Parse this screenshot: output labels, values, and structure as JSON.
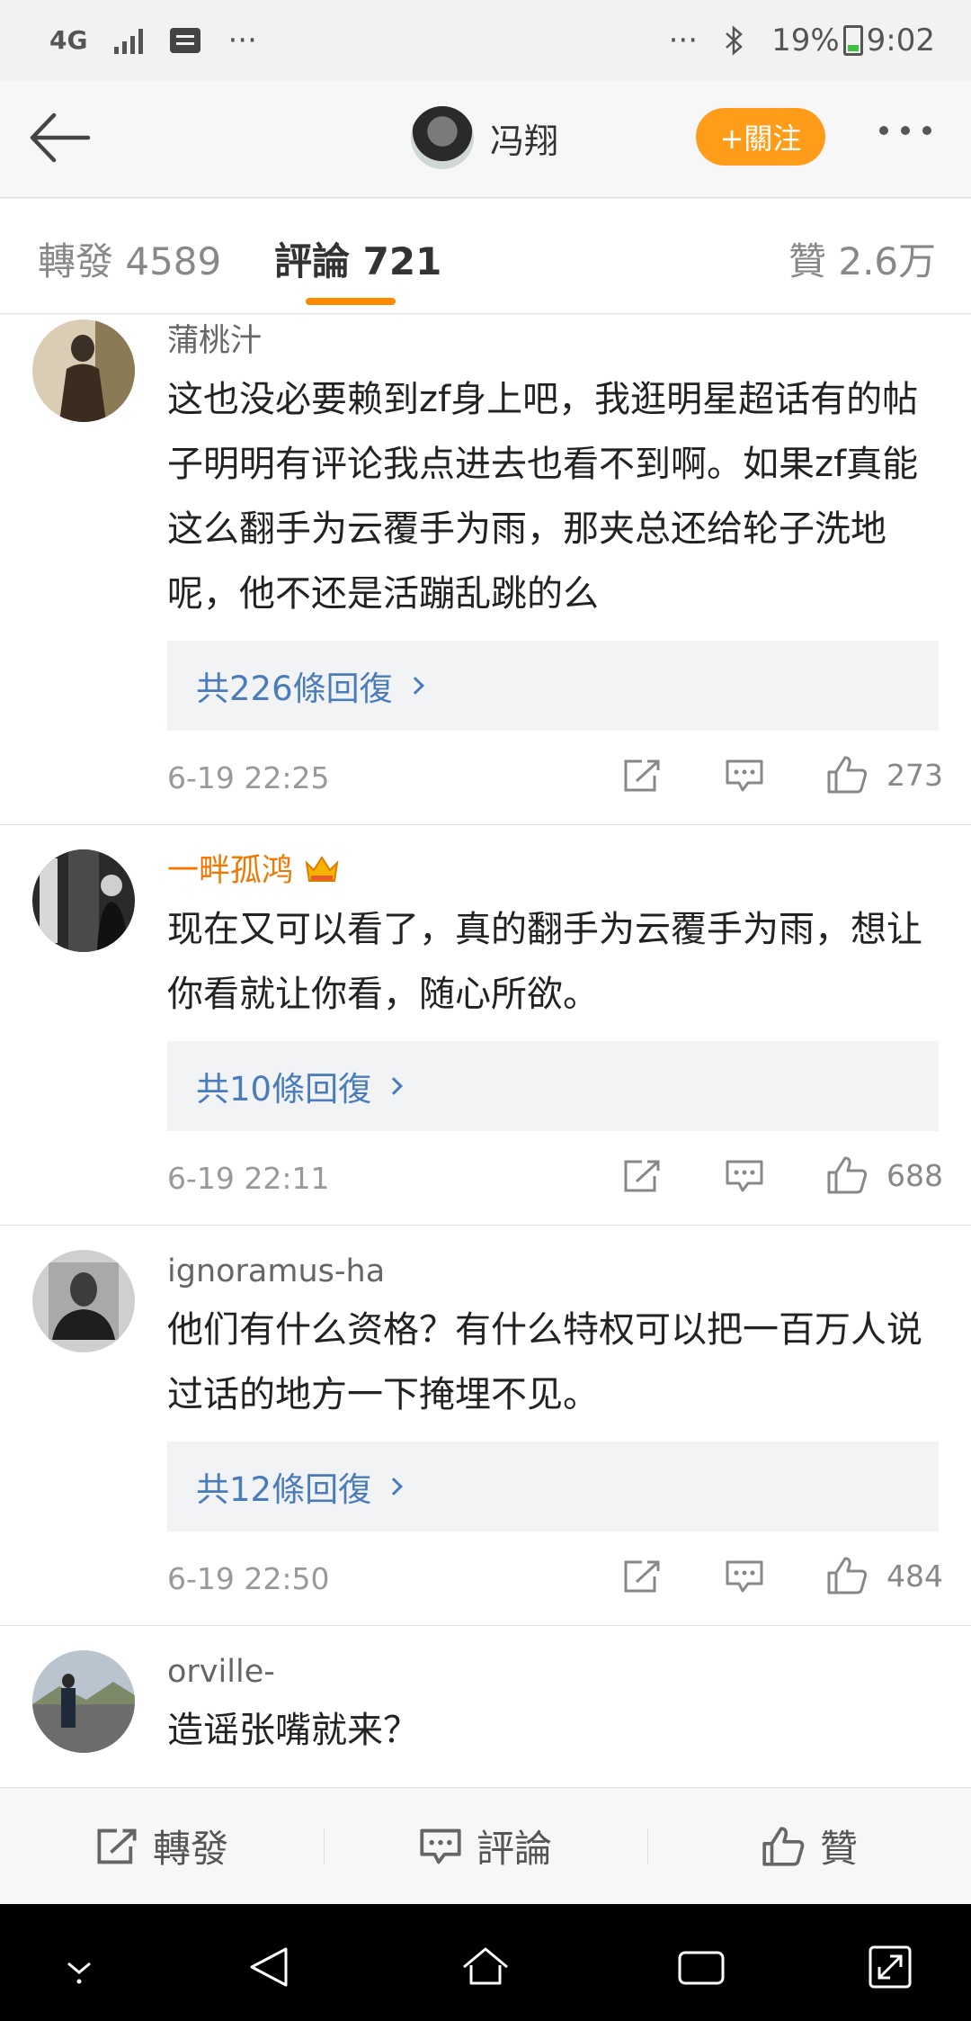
{
  "status_bar": {
    "network": "4G",
    "left_more": "···",
    "right_more": "···",
    "battery": "19%",
    "time": "9:02"
  },
  "header": {
    "title": "冯翔",
    "follow_label": "+關注"
  },
  "tabs": [
    {
      "label": "轉發 4589"
    },
    {
      "label": "評論 721"
    },
    {
      "label": "贊 2.6万"
    }
  ],
  "comments": [
    {
      "user": "蒲桃汁",
      "vip": false,
      "text": "这也没必要赖到zf身上吧，我逛明星超话有的帖子明明有评论我点进去也看不到啊。如果zf真能这么翻手为云覆手为雨，那夹总还给轮子洗地呢，他不还是活蹦乱跳的么",
      "replies": "共226條回復",
      "time": "6-19 22:25",
      "likes": "273"
    },
    {
      "user": "一畔孤鸿",
      "vip": true,
      "text": "现在又可以看了，真的翻手为云覆手为雨，想让你看就让你看，随心所欲。",
      "replies": "共10條回復",
      "time": "6-19 22:11",
      "likes": "688"
    },
    {
      "user": "ignoramus-ha",
      "vip": false,
      "text": "他们有什么资格？有什么特权可以把一百万人说过话的地方一下掩埋不见。",
      "replies": "共12條回復",
      "time": "6-19 22:50",
      "likes": "484"
    },
    {
      "user": "orville-",
      "vip": false,
      "text": "造谣张嘴就来？"
    }
  ],
  "bottom_bar": {
    "repost": "轉發",
    "comment": "評論",
    "like": "贊"
  },
  "colors": {
    "accent_orange": "#ff9c1a",
    "link_blue": "#4a7cbb",
    "vip_name": "#f07800"
  }
}
